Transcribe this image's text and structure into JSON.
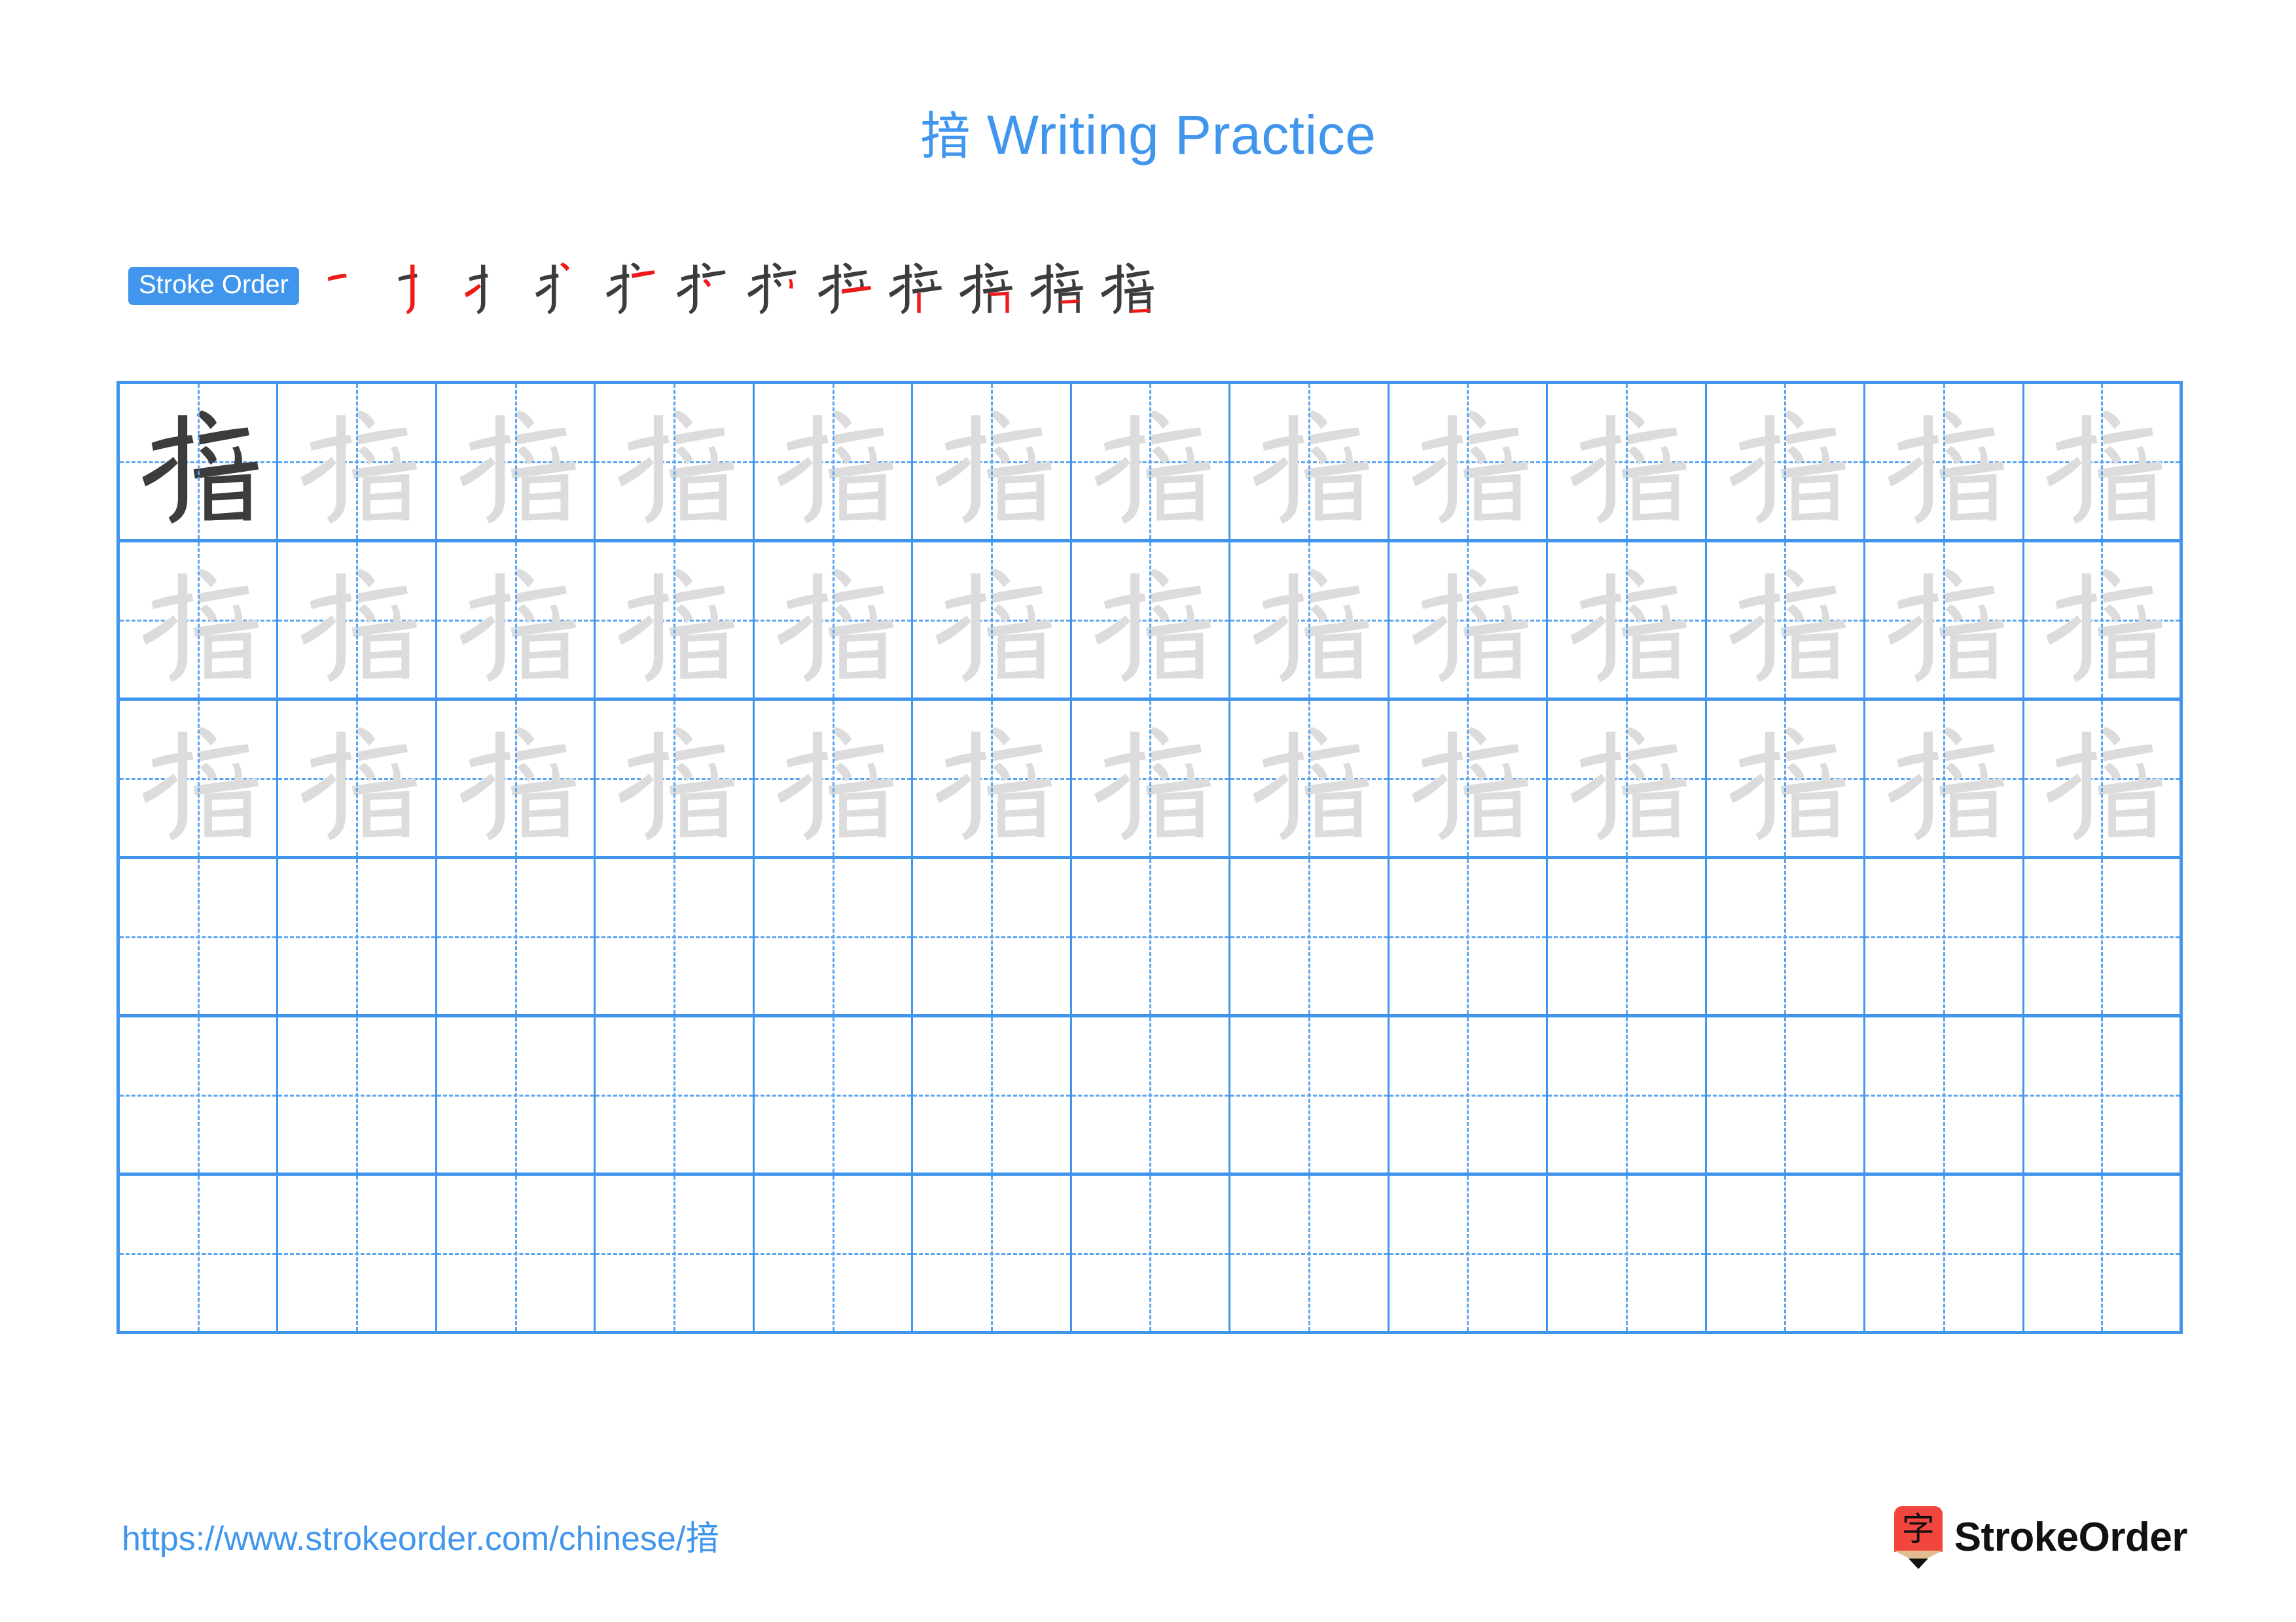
{
  "page": {
    "background_color": "#FFFFFF",
    "accent_blue": "#4095ED",
    "grid_line_blue": "#4095ED",
    "grid_dash_blue": "#5BA5F0",
    "trace_gray": "#DCDCDC",
    "ink_dark": "#3C3C3C",
    "new_stroke_red": "#EE1B1B",
    "logo_red": "#F2453D"
  },
  "header": {
    "character": "揞",
    "title_suffix": " Writing Practice",
    "title_full": "揞 Writing Practice"
  },
  "stroke_order": {
    "badge_label": "Stroke Order",
    "total_strokes": 12,
    "steps": [
      {
        "index": 1,
        "glyph": "一",
        "new_stroke": "heng (horizontal)"
      },
      {
        "index": 2,
        "glyph": "二",
        "new_stroke": "shu-gou (vertical hook)"
      },
      {
        "index": 3,
        "glyph": "扌",
        "new_stroke": "ti (rising)"
      },
      {
        "index": 4,
        "glyph": "才",
        "new_stroke": "dian (dot)"
      },
      {
        "index": 5,
        "glyph": "払",
        "new_stroke": "heng (horizontal)"
      },
      {
        "index": 6,
        "glyph": "扣",
        "new_stroke": "dian (dot)"
      },
      {
        "index": 7,
        "glyph": "扩",
        "new_stroke": "shu (vertical)"
      },
      {
        "index": 8,
        "glyph": "拉",
        "new_stroke": "heng (horizontal)"
      },
      {
        "index": 9,
        "glyph": "护",
        "new_stroke": "shu (vertical)"
      },
      {
        "index": 10,
        "glyph": "括",
        "new_stroke": "heng-zhe (horizontal turn)"
      },
      {
        "index": 11,
        "glyph": "揞",
        "new_stroke": "heng (horizontal)"
      },
      {
        "index": 12,
        "glyph": "揞",
        "new_stroke": "heng (horizontal, final)"
      }
    ]
  },
  "grid": {
    "columns": 13,
    "rows": 6,
    "cell_character": "揞",
    "row_states": [
      {
        "row": 1,
        "type": "trace",
        "first_cell": "solid",
        "note": "first cell dark model character, remaining 12 light trace"
      },
      {
        "row": 2,
        "type": "trace",
        "first_cell": "trace",
        "note": "13 light trace characters"
      },
      {
        "row": 3,
        "type": "trace",
        "first_cell": "trace",
        "note": "13 light trace characters"
      },
      {
        "row": 4,
        "type": "blank",
        "first_cell": "blank",
        "note": "empty practice row"
      },
      {
        "row": 5,
        "type": "blank",
        "first_cell": "blank",
        "note": "empty practice row"
      },
      {
        "row": 6,
        "type": "blank",
        "first_cell": "blank",
        "note": "empty practice row"
      }
    ]
  },
  "footer": {
    "url": "https://www.strokeorder.com/chinese/揞",
    "url_prefix": "https://www.strokeorder.com/chinese/",
    "url_character": "揞",
    "logo_mark_character": "字",
    "logo_text": "StrokeOrder"
  }
}
